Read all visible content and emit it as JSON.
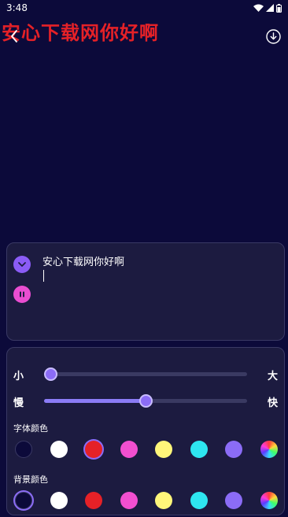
{
  "status_bar": {
    "time": "3:48",
    "icons": [
      "wifi-icon",
      "signal-icon",
      "battery-icon"
    ]
  },
  "display": {
    "marquee_text": "安心下载网你好啊",
    "marquee_color": "#e52127",
    "background_color": "#0c0a3a"
  },
  "header": {
    "back_icon": "chevron-left-icon",
    "download_icon": "download-circle-icon"
  },
  "input_panel": {
    "text_value": "安心下载网你好啊",
    "collapse_icon": "chevron-down-icon",
    "pause_icon": "pause-icon"
  },
  "settings": {
    "size_slider": {
      "min_label": "小",
      "max_label": "大",
      "value": 0.0
    },
    "speed_slider": {
      "min_label": "慢",
      "max_label": "快",
      "value": 0.5
    },
    "font_color_label": "字体颜色",
    "font_colors": [
      "#0c0a3a",
      "#ffffff",
      "#e52127",
      "#f24fd0",
      "#fff67a",
      "#2ee6f0",
      "#8b6cf6",
      "rainbow"
    ],
    "font_color_selected": 2,
    "bg_color_label": "背景颜色",
    "bg_colors": [
      "#0c0a3a",
      "#ffffff",
      "#e52127",
      "#f24fd0",
      "#fff67a",
      "#2ee6f0",
      "#8b6cf6",
      "rainbow"
    ],
    "bg_color_selected": 0
  }
}
